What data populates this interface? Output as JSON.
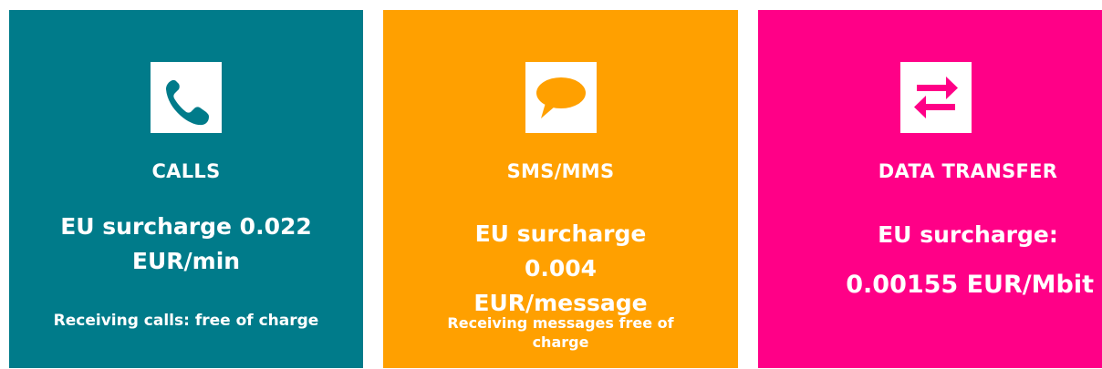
{
  "colors": {
    "calls": "#007b8a",
    "sms": "#ffa000",
    "data": "#ff0087"
  },
  "cards": [
    {
      "icon": "phone-icon",
      "title": "CALLS",
      "surcharge_line1": "EU surcharge 0.022",
      "surcharge_line2": "EUR/min",
      "note": "Receiving calls: free of charge"
    },
    {
      "icon": "speech-bubble-icon",
      "title": "SMS/MMS",
      "surcharge_line1": "EU surcharge",
      "surcharge_line2": "0.004",
      "surcharge_line3": "EUR/message",
      "note_line1": "Receiving messages free of",
      "note_line2": "charge"
    },
    {
      "icon": "transfer-arrows-icon",
      "title": "DATA TRANSFER",
      "surcharge_line1": "EU surcharge:",
      "surcharge_line2": "0.00155 EUR/Mbit"
    }
  ]
}
